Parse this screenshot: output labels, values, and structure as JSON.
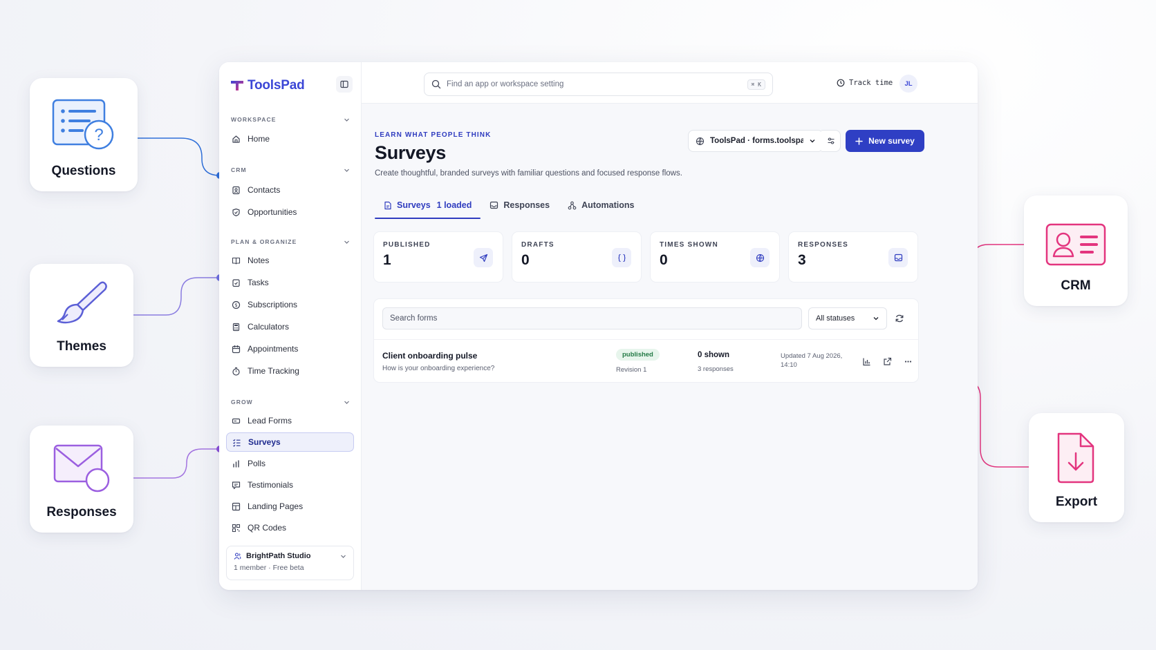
{
  "features": {
    "questions": "Questions",
    "themes": "Themes",
    "responses": "Responses",
    "crm": "CRM",
    "export": "Export"
  },
  "colors": {
    "accent": "#2f3fc4",
    "connector_blue": "#2f6fd9",
    "connector_purple": "#8a4fd8",
    "connector_pink": "#e3347e"
  },
  "brand": {
    "name": "ToolsPad"
  },
  "sidebar": {
    "sections": [
      {
        "title": "WORKSPACE",
        "items": [
          {
            "label": "Home",
            "icon": "home-icon"
          }
        ]
      },
      {
        "title": "CRM",
        "items": [
          {
            "label": "Contacts",
            "icon": "contacts-icon"
          },
          {
            "label": "Opportunities",
            "icon": "opportunities-icon"
          }
        ]
      },
      {
        "title": "PLAN & ORGANIZE",
        "items": [
          {
            "label": "Notes",
            "icon": "notes-icon"
          },
          {
            "label": "Tasks",
            "icon": "tasks-icon"
          },
          {
            "label": "Subscriptions",
            "icon": "subscriptions-icon"
          },
          {
            "label": "Calculators",
            "icon": "calculator-icon"
          },
          {
            "label": "Appointments",
            "icon": "calendar-icon"
          },
          {
            "label": "Time Tracking",
            "icon": "timer-icon"
          }
        ]
      },
      {
        "title": "GROW",
        "items": [
          {
            "label": "Lead Forms",
            "icon": "form-icon"
          },
          {
            "label": "Surveys",
            "icon": "survey-icon",
            "active": true
          },
          {
            "label": "Polls",
            "icon": "poll-icon"
          },
          {
            "label": "Testimonials",
            "icon": "testimonials-icon"
          },
          {
            "label": "Landing Pages",
            "icon": "landing-page-icon"
          },
          {
            "label": "QR Codes",
            "icon": "qr-code-icon"
          }
        ]
      }
    ],
    "workspace": {
      "name": "BrightPath Studio",
      "meta": "1 member · Free beta"
    }
  },
  "topbar": {
    "search_placeholder": "Find an app or workspace setting",
    "shortcut": "⌘ K",
    "track_time": "Track time",
    "avatar_initials": "JL"
  },
  "page": {
    "eyebrow": "LEARN WHAT PEOPLE THINK",
    "title": "Surveys",
    "description": "Create thoughtful, branded surveys with familiar questions and focused response flows.",
    "workspace_select": "ToolsPad · forms.toolspad",
    "new_button": "New survey"
  },
  "tabs": [
    {
      "label": "Surveys",
      "count": "1 loaded",
      "active": true
    },
    {
      "label": "Responses"
    },
    {
      "label": "Automations"
    }
  ],
  "stats": [
    {
      "label": "PUBLISHED",
      "value": "1",
      "icon": "send-icon"
    },
    {
      "label": "DRAFTS",
      "value": "0",
      "icon": "braces-icon"
    },
    {
      "label": "TIMES SHOWN",
      "value": "0",
      "icon": "globe-icon"
    },
    {
      "label": "RESPONSES",
      "value": "3",
      "icon": "inbox-icon"
    }
  ],
  "list": {
    "search_placeholder": "Search forms",
    "status_filter": "All statuses",
    "rows": [
      {
        "name": "Client onboarding pulse",
        "question": "How is your onboarding experience?",
        "status": "published",
        "revision": "Revision 1",
        "shown": "0 shown",
        "responses": "3 responses",
        "updated": "Updated 7 Aug 2026, 14:10"
      }
    ]
  }
}
